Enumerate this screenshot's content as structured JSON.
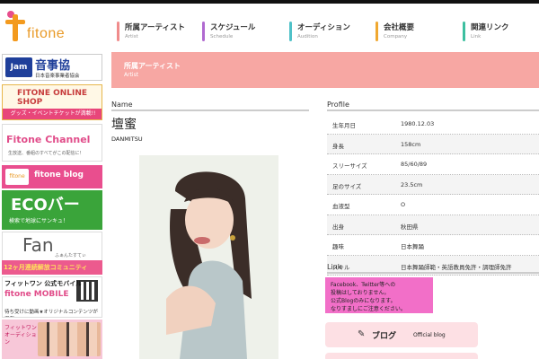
{
  "brand": {
    "name": "fitone"
  },
  "nav": [
    {
      "jp": "所属アーティスト",
      "en": "Artist",
      "color": "#f08c8c"
    },
    {
      "jp": "スケジュール",
      "en": "Schedule",
      "color": "#b06ad0"
    },
    {
      "jp": "オーディション",
      "en": "Audition",
      "color": "#4fc1c8"
    },
    {
      "jp": "会社概要",
      "en": "Company",
      "color": "#f0a830"
    },
    {
      "jp": "関連リンク",
      "en": "Link",
      "color": "#3dbfa0"
    }
  ],
  "sidebar": {
    "banners": [
      {
        "title": "音事協",
        "jam": "Jam",
        "sub": "日本音楽事業者協会"
      },
      {
        "title": "FITONE ONLINE SHOP",
        "sub": "グッズ・イベントチケットが満載!!"
      },
      {
        "title": "Fitone Channel",
        "sub": "生放送、番組のすべてがこの配信に！"
      },
      {
        "title": "fitone blog",
        "icon": "fitone"
      },
      {
        "title": "ECOバー",
        "sub": "検索で地球にサンキュ！"
      },
      {
        "title": "Fan",
        "sub": "ふぁんたすてぃ"
      },
      {
        "title": "12ヶ月連続解放コミュニティ"
      },
      {
        "title1": "フィットワン 公式モバイル",
        "title2": "fitone MOBILE",
        "sub": "待ち受けに動画★オリジナルコンテンツが満載!"
      },
      {
        "title": "フィットワン オーディション"
      }
    ]
  },
  "header": {
    "jp": "所属アーティスト",
    "en": "Artist"
  },
  "sections": {
    "name": "Name",
    "profile": "Profile",
    "link": "Link"
  },
  "artist": {
    "name": "壇蜜",
    "roman": "DANMITSU"
  },
  "profile": [
    {
      "k": "生年月日",
      "v": "1980.12.03"
    },
    {
      "k": "身長",
      "v": "158cm"
    },
    {
      "k": "スリーサイズ",
      "v": "85/60/89"
    },
    {
      "k": "足のサイズ",
      "v": "23.5cm"
    },
    {
      "k": "血液型",
      "v": "O"
    },
    {
      "k": "出身",
      "v": "秋田県"
    },
    {
      "k": "趣味",
      "v": "日本舞踊"
    },
    {
      "k": "スキル",
      "v": "日本舞踊師範・英語教員免許・調理師免許"
    }
  ],
  "notice": {
    "line1": "Facebook、Twitter等への",
    "line2": "投稿はしておりません。",
    "line3": "公式Blogのみになります。",
    "line4": "なりすましにご注意ください。"
  },
  "links": {
    "blog_label": "ブログ",
    "blog_sub": "Official blog"
  }
}
